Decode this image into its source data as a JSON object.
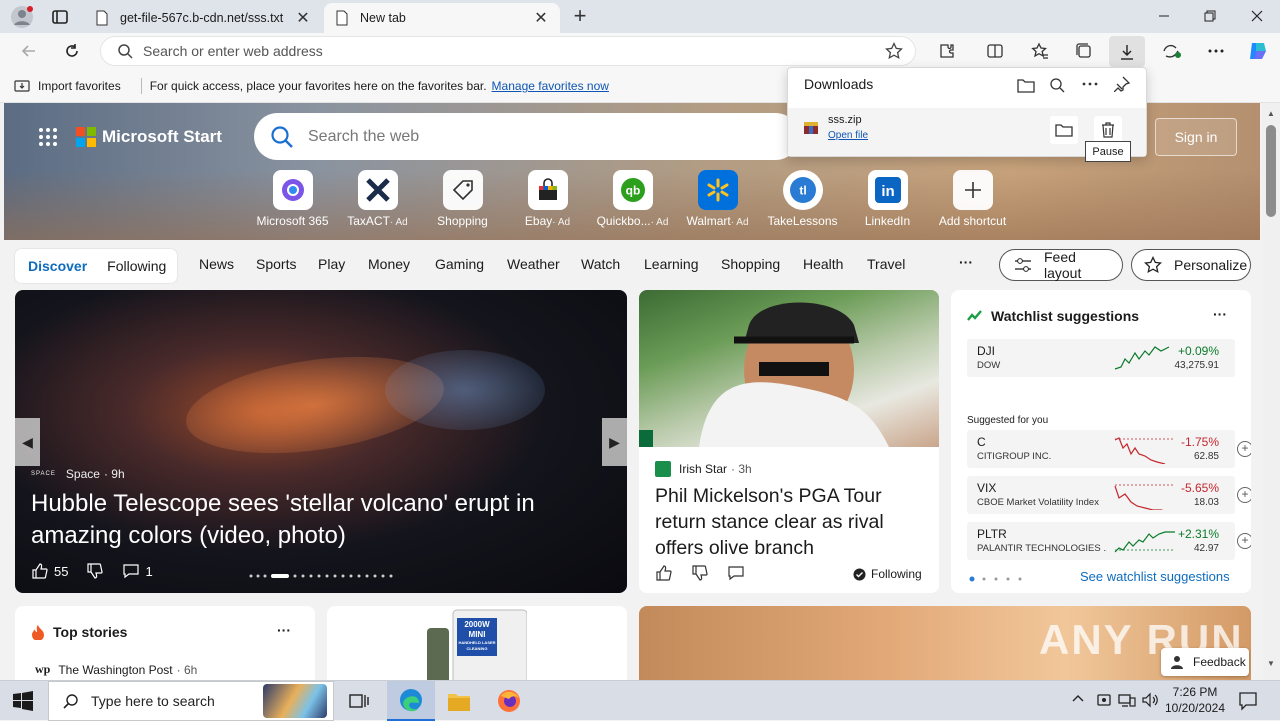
{
  "tabs": [
    {
      "title": "get-file-567c.b-cdn.net/sss.txt",
      "close": "✕"
    },
    {
      "title": "New tab",
      "close": "✕"
    }
  ],
  "new_tab": "+",
  "address_bar": {
    "placeholder": "Search or enter web address"
  },
  "favorites_bar": {
    "import_label": "Import favorites",
    "message": "For quick access, place your favorites here on the favorites bar.",
    "manage_link": "Manage favorites now"
  },
  "downloads": {
    "title": "Downloads",
    "file_name": "sss.zip",
    "open_file": "Open file",
    "tooltip": "Pause"
  },
  "msstart": {
    "brand": "Microsoft Start",
    "search_placeholder": "Search the web",
    "sign_in": "Sign in",
    "shortcuts": [
      {
        "label": "Microsoft 365",
        "ad": ""
      },
      {
        "label": "TaxACT",
        "ad": "· Ad"
      },
      {
        "label": "Shopping",
        "ad": ""
      },
      {
        "label": "Ebay",
        "ad": "· Ad"
      },
      {
        "label": "Quickbo...",
        "ad": "· Ad"
      },
      {
        "label": "Walmart",
        "ad": "· Ad"
      },
      {
        "label": "TakeLessons",
        "ad": ""
      },
      {
        "label": "LinkedIn",
        "ad": ""
      },
      {
        "label": "Add shortcut",
        "ad": ""
      }
    ]
  },
  "nav": {
    "discover": "Discover",
    "following": "Following",
    "items": [
      "News",
      "Sports",
      "Play",
      "Money",
      "Gaming",
      "Weather",
      "Watch",
      "Learning",
      "Shopping",
      "Health",
      "Travel"
    ],
    "more": "···",
    "feed_layout": "Feed layout",
    "personalize": "Personalize"
  },
  "hero_story": {
    "source": "Space",
    "age": "· 9h",
    "headline": "Hubble Telescope sees 'stellar volcano' erupt in amazing colors (video, photo)",
    "likes": "55",
    "comments": "1"
  },
  "golf_story": {
    "source": "Irish Star",
    "age": "· 3h",
    "headline": "Phil Mickelson's PGA Tour return stance clear as rival offers olive branch",
    "following": "Following"
  },
  "watchlist": {
    "title": "Watchlist suggestions",
    "more": "···",
    "suggested_label": "Suggested for you",
    "see_more": "See watchlist suggestions",
    "index": {
      "symbol": "DJI",
      "name": "DOW",
      "change": "+0.09%",
      "price": "43,275.91"
    },
    "stocks": [
      {
        "symbol": "C",
        "name": "CITIGROUP INC.",
        "change": "-1.75%",
        "price": "62.85"
      },
      {
        "symbol": "VIX",
        "name": "CBOE Market Volatility Index",
        "change": "-5.65%",
        "price": "18.03"
      },
      {
        "symbol": "PLTR",
        "name": "PALANTIR TECHNOLOGIES ...",
        "change": "+2.31%",
        "price": "42.97"
      }
    ],
    "up_color": "#0b7a2a",
    "down_color": "#c4262e"
  },
  "top_stories": {
    "title": "Top stories",
    "more": "···",
    "first_source": "The Washington Post",
    "first_age": "· 6h",
    "source_logo": "wp"
  },
  "ad_box": {
    "line1": "2000W",
    "line2": "MINI",
    "line3": "HANDHELD LASER CLEANING"
  },
  "watermark": "ANY RUN",
  "feedback": "Feedback",
  "taskbar": {
    "search_placeholder": "Type here to search",
    "time": "7:26 PM",
    "date": "10/20/2024"
  }
}
